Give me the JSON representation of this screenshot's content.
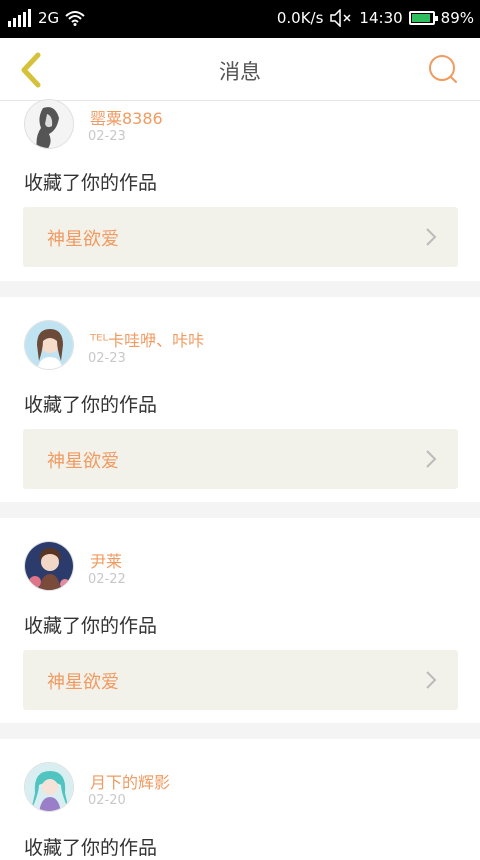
{
  "status_bar": {
    "carrier": "2G",
    "speed": "0.0K/s",
    "time": "14:30",
    "battery_percent": "89%",
    "battery_level": 0.89
  },
  "header": {
    "title": "消息"
  },
  "messages": [
    {
      "name": "罂粟8386",
      "date": "02-23",
      "action": "收藏了你的作品",
      "work_title": "神星欲爱"
    },
    {
      "name": "ᵀᴱᴸ卡哇咿、咔咔",
      "date": "02-23",
      "action": "收藏了你的作品",
      "work_title": "神星欲爱"
    },
    {
      "name": "尹莱",
      "date": "02-22",
      "action": "收藏了你的作品",
      "work_title": "神星欲爱"
    },
    {
      "name": "月下的辉影",
      "date": "02-20",
      "action": "收藏了你的作品"
    }
  ],
  "colors": {
    "accent": "#f09b62",
    "card_bg": "#f2f1ea",
    "back_arrow": "#d6c13a"
  }
}
